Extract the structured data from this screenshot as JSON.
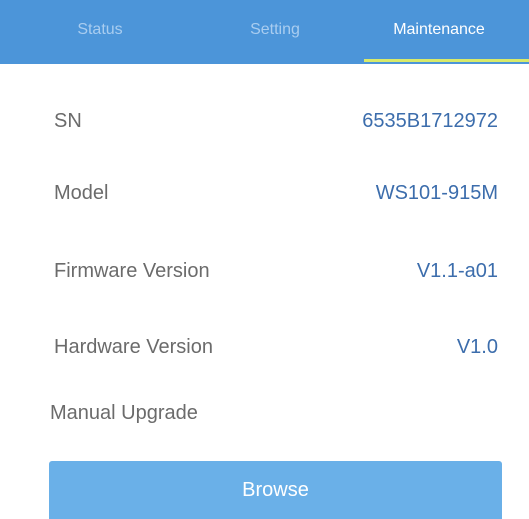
{
  "tabs": {
    "status": "Status",
    "setting": "Setting",
    "maintenance": "Maintenance",
    "active": "maintenance"
  },
  "info": {
    "sn": {
      "label": "SN",
      "value": "6535B1712972"
    },
    "model": {
      "label": "Model",
      "value": "WS101-915M"
    },
    "firmware": {
      "label": "Firmware Version",
      "value": "V1.1-a01"
    },
    "hardware": {
      "label": "Hardware Version",
      "value": "V1.0"
    }
  },
  "upgrade": {
    "label": "Manual Upgrade",
    "button_label": "Browse"
  },
  "colors": {
    "tab_bar": "#4c95d9",
    "tab_indicator": "#d8ea6b",
    "value_text": "#3c6dac",
    "button": "#6ab0e8"
  }
}
